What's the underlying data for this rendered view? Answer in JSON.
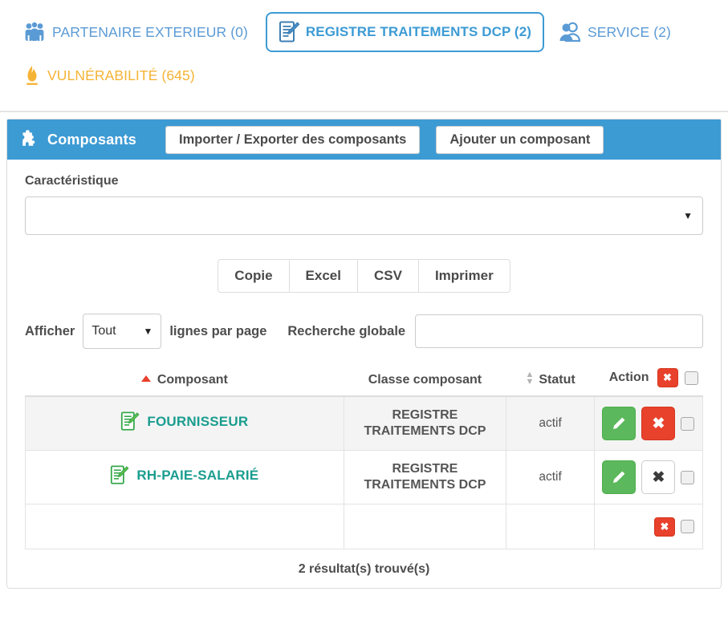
{
  "tabs": [
    {
      "id": "partenaire-exterieur",
      "label": "PARTENAIRE EXTERIEUR (0)",
      "icon": "people-group-icon",
      "color": "#5b9bd5",
      "active": false
    },
    {
      "id": "registre-traitements-dcp",
      "label": "REGISTRE TRAITEMENTS DCP (2)",
      "icon": "document-edit-icon",
      "color": "#3d9bd4",
      "active": true
    },
    {
      "id": "service",
      "label": "SERVICE (2)",
      "icon": "users-icon",
      "color": "#5b9bd5",
      "active": false
    },
    {
      "id": "vulnerabilite",
      "label": "VULNÉRABILITÉ (645)",
      "icon": "flame-icon",
      "color": "#f5b335",
      "active": false
    }
  ],
  "panel": {
    "title": "Composants",
    "title_icon": "puzzle-piece-icon",
    "header_color": "#3d9bd4",
    "buttons": [
      {
        "id": "importer-exporter",
        "label": "Importer / Exporter des composants"
      },
      {
        "id": "ajouter-composant",
        "label": "Ajouter un composant"
      }
    ]
  },
  "filter": {
    "label": "Caractéristique",
    "value": "",
    "caret": "▼"
  },
  "export_buttons": [
    {
      "id": "copie",
      "label": "Copie"
    },
    {
      "id": "excel",
      "label": "Excel"
    },
    {
      "id": "csv",
      "label": "CSV"
    },
    {
      "id": "imprimer",
      "label": "Imprimer"
    }
  ],
  "controls": {
    "afficher_label": "Afficher",
    "page_length_value": "Tout",
    "page_length_caret": "▼",
    "lignes_label": "lignes par page",
    "search_label": "Recherche globale",
    "search_value": "",
    "search_placeholder": ""
  },
  "table": {
    "columns": [
      {
        "id": "composant",
        "label": "Composant",
        "sort": "asc"
      },
      {
        "id": "classe-composant",
        "label": "Classe composant",
        "sort": "none-hidden"
      },
      {
        "id": "statut",
        "label": "Statut",
        "sort": "both"
      },
      {
        "id": "action",
        "label": "Action",
        "sort": "none-hidden"
      }
    ],
    "header_delete_glyph": "✖",
    "rows": [
      {
        "name": "FOURNISSEUR",
        "icon": "document-edit-green-icon",
        "classe": "REGISTRE TRAITEMENTS DCP",
        "statut": "actif",
        "edit_glyph": "✎",
        "delete_glyph": "✖",
        "delete_style": "red",
        "checked": false
      },
      {
        "name": "RH-PAIE-SALARIÉ",
        "icon": "document-edit-green-icon",
        "classe": "REGISTRE TRAITEMENTS DCP",
        "statut": "actif",
        "edit_glyph": "✎",
        "delete_glyph": "✖",
        "delete_style": "white",
        "checked": false
      }
    ],
    "footer_delete_glyph": "✖"
  },
  "result_count": "2 résultat(s) trouvé(s)",
  "colors": {
    "brand_blue": "#3d9bd4",
    "tab_blue": "#5b9bd5",
    "amber": "#f5b335",
    "teal": "#1a9d8f",
    "green": "#5cb85c",
    "red": "#e8412c"
  }
}
